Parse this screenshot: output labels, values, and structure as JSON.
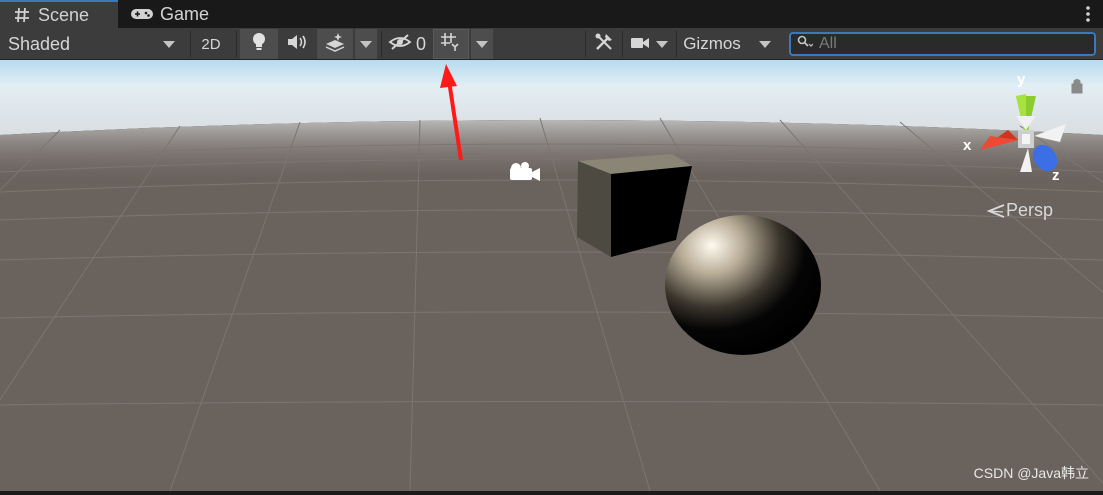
{
  "tabs": [
    {
      "label": "Scene",
      "icon": "hash-icon",
      "active": true
    },
    {
      "label": "Game",
      "icon": "gamepad-icon",
      "active": false
    }
  ],
  "toolbar": {
    "shading_mode": "Shaded",
    "mode_2d_label": "2D",
    "hidden_count": "0",
    "gizmos_label": "Gizmos"
  },
  "search": {
    "placeholder": "All",
    "value": ""
  },
  "scene": {
    "view_mode": "Persp",
    "axes": {
      "x": "x",
      "y": "y",
      "z": "z"
    }
  },
  "watermark": "CSDN @Java韩立",
  "colors": {
    "accent_blue": "#3a79bb",
    "annotation_arrow": "#ff0000",
    "axis_x": "#d2321e",
    "axis_y": "#8ccc2c",
    "axis_z": "#3c6ee6"
  }
}
